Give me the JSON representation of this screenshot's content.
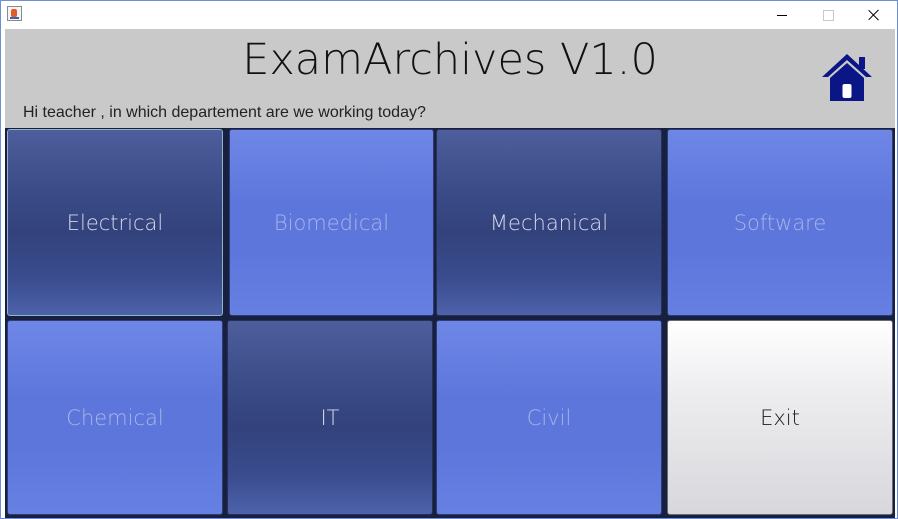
{
  "window": {
    "icon": "java-cup-icon",
    "controls": {
      "minimize": "minimize-icon",
      "maximize": "maximize-icon",
      "close": "close-icon"
    }
  },
  "header": {
    "title": "ExamArchives V1.0",
    "greeting": "Hi teacher , in which departement are we working today?",
    "home_icon": "home-icon",
    "home_color": "#0a1685"
  },
  "departments": [
    {
      "label": "Electrical"
    },
    {
      "label": "Biomedical"
    },
    {
      "label": "Mechanical"
    },
    {
      "label": "Software"
    },
    {
      "label": "Chemical"
    },
    {
      "label": "IT"
    },
    {
      "label": "Civil"
    }
  ],
  "exit_label": "Exit",
  "colors": {
    "header_bg": "#c9c9c9",
    "tile_dark": "#33427c",
    "tile_light": "#5d76dc",
    "tile_exit": "#e8e8ec"
  }
}
